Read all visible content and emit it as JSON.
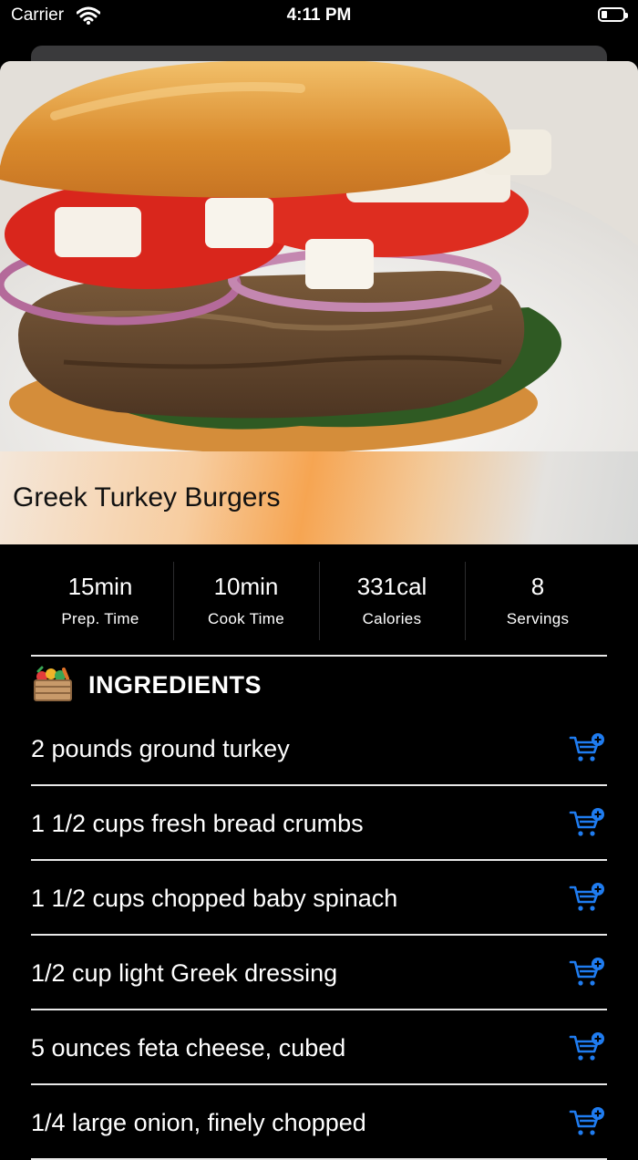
{
  "status_bar": {
    "carrier": "Carrier",
    "time": "4:11 PM"
  },
  "recipe": {
    "title": "Greek Turkey Burgers"
  },
  "stats": [
    {
      "value": "15min",
      "label": "Prep. Time"
    },
    {
      "value": "10min",
      "label": "Cook Time"
    },
    {
      "value": "331cal",
      "label": "Calories"
    },
    {
      "value": "8",
      "label": "Servings"
    }
  ],
  "ingredients": {
    "title": "INGREDIENTS",
    "items": [
      "2 pounds ground turkey",
      "1 1/2 cups fresh bread crumbs",
      "1 1/2 cups chopped baby spinach",
      "1/2 cup light Greek dressing",
      "5 ounces feta cheese, cubed",
      "1/4 large onion, finely chopped"
    ]
  },
  "colors": {
    "accent": "#1f7cf0",
    "background": "#000000",
    "title_band_orange": "#f6a552"
  },
  "icons": {
    "wifi": "wifi-icon",
    "battery": "battery-icon",
    "crate": "vegetable-crate-icon",
    "cart": "cart-add-icon"
  }
}
